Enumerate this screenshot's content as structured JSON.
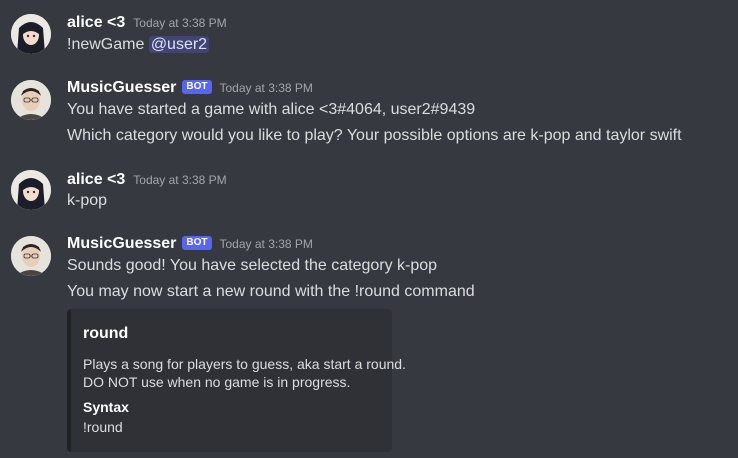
{
  "messages": [
    {
      "author": "alice <3",
      "timestamp": "Today at 3:38 PM",
      "lines": [
        "!newGame "
      ],
      "mention": "@user2"
    },
    {
      "author": "MusicGuesser",
      "bot_tag": "BOT",
      "timestamp": "Today at 3:38 PM",
      "lines": [
        "You have started a game with alice <3#4064, user2#9439",
        "Which category would you like to play? Your possible options are k-pop and taylor swift"
      ]
    },
    {
      "author": "alice <3",
      "timestamp": "Today at 3:38 PM",
      "lines": [
        "k-pop"
      ]
    },
    {
      "author": "MusicGuesser",
      "bot_tag": "BOT",
      "timestamp": "Today at 3:38 PM",
      "lines": [
        "Sounds good! You have selected the category k-pop",
        "You may now start a new round with the !round command"
      ],
      "embed": {
        "title": "round",
        "description": [
          "Plays a song for players to guess, aka start a round.",
          "DO NOT use when no game is in progress."
        ],
        "field_name": "Syntax",
        "field_value": "!round"
      }
    }
  ],
  "colors": {
    "background": "#36393f",
    "embed_background": "#2f3136",
    "bot_tag": "#5865f2",
    "mention_text": "#dee0fc"
  },
  "icons": {
    "alice_avatar": "avatar-anime-girl-icon",
    "bot_avatar": "avatar-man-glasses-icon"
  }
}
